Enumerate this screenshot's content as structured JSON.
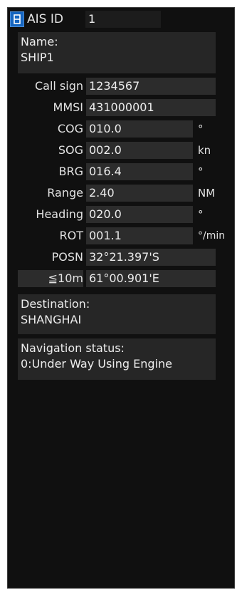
{
  "header": {
    "ais_id_label": "AIS ID",
    "ais_id_value": "1"
  },
  "name": {
    "label": "Name:",
    "value": "SHIP1"
  },
  "fields": [
    {
      "label": "Call sign",
      "value": "1234567",
      "unit": ""
    },
    {
      "label": "MMSI",
      "value": "431000001",
      "unit": ""
    },
    {
      "label": "COG",
      "value": "010.0",
      "unit": "°"
    },
    {
      "label": "SOG",
      "value": "002.0",
      "unit": "kn"
    },
    {
      "label": "BRG",
      "value": "016.4",
      "unit": "°"
    },
    {
      "label": "Range",
      "value": "2.40",
      "unit": "NM"
    },
    {
      "label": "Heading",
      "value": "020.0",
      "unit": "°"
    },
    {
      "label": "ROT",
      "value": "001.1",
      "unit": "°/min"
    },
    {
      "label": "POSN",
      "value": "32°21.397'S",
      "unit": ""
    },
    {
      "label": "≦10m",
      "value": "61°00.901'E",
      "unit": ""
    }
  ],
  "destination": {
    "label": "Destination:",
    "value": "SHANGHAI"
  },
  "navigation_status": {
    "label": "Navigation status:",
    "value": "0:Under Way Using Engine"
  },
  "colors": {
    "panel_background": "#101010",
    "cell_background": "#2c2c2c",
    "text": "#e6e6e6",
    "accent": "#1565c0"
  },
  "icons": {
    "expand": "expand-icon"
  }
}
